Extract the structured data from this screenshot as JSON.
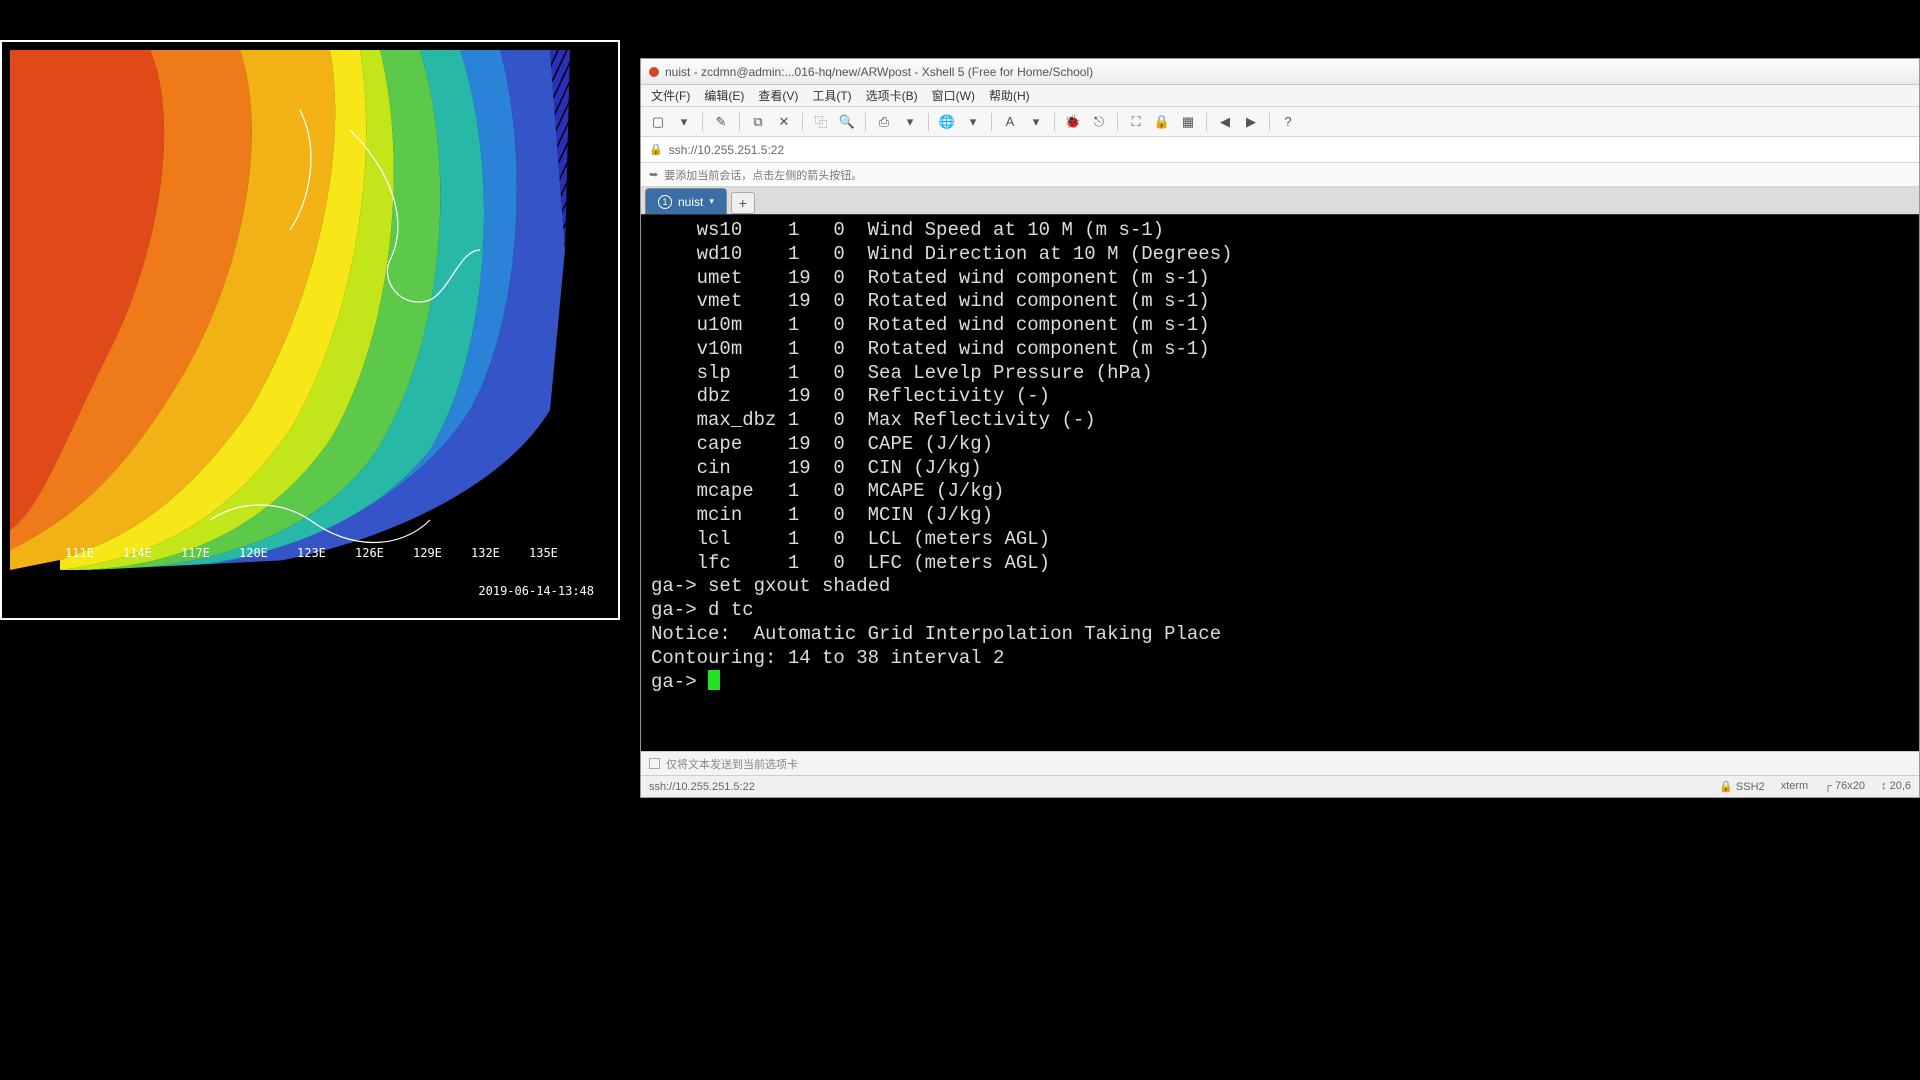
{
  "plot": {
    "axis_labels": [
      "111E",
      "114E",
      "117E",
      "120E",
      "123E",
      "126E",
      "129E",
      "132E",
      "135E"
    ],
    "timestamp": "2019-06-14-13:48"
  },
  "xshell": {
    "title": "nuist - zcdmn@admin:...016-hq/new/ARWpost - Xshell 5 (Free for Home/School)",
    "menu": [
      "文件(F)",
      "编辑(E)",
      "查看(V)",
      "工具(T)",
      "选项卡(B)",
      "窗口(W)",
      "帮助(H)"
    ],
    "toolbar_icons": [
      "new",
      "open",
      "|",
      "wand",
      "|",
      "copy",
      "x",
      "|",
      "dup",
      "search",
      "|",
      "print",
      "dd",
      "|",
      "globe",
      "dd",
      "|",
      "font",
      "dd",
      "|",
      "bug",
      "exit",
      "|",
      "full",
      "lock",
      "tile",
      "|",
      "left",
      "right",
      "|",
      "help"
    ],
    "address": "ssh://10.255.251.5:22",
    "hint": "要添加当前会话，点击左侧的箭头按钮。",
    "tab": {
      "index": "1",
      "label": "nuist"
    },
    "compose_hint": "仅将文本发送到当前选项卡",
    "status": {
      "left": "ssh://10.255.251.5:22",
      "ssh": "SSH2",
      "term": "xterm",
      "size": "76x20",
      "pos": "20,6"
    }
  },
  "terminal": {
    "vars": [
      {
        "name": "ws10",
        "a": "1",
        "b": "0",
        "desc": "Wind Speed at 10 M (m s-1)"
      },
      {
        "name": "wd10",
        "a": "1",
        "b": "0",
        "desc": "Wind Direction at 10 M (Degrees)"
      },
      {
        "name": "umet",
        "a": "19",
        "b": "0",
        "desc": "Rotated wind component (m s-1)"
      },
      {
        "name": "vmet",
        "a": "19",
        "b": "0",
        "desc": "Rotated wind component (m s-1)"
      },
      {
        "name": "u10m",
        "a": "1",
        "b": "0",
        "desc": "Rotated wind component (m s-1)"
      },
      {
        "name": "v10m",
        "a": "1",
        "b": "0",
        "desc": "Rotated wind component (m s-1)"
      },
      {
        "name": "slp",
        "a": "1",
        "b": "0",
        "desc": "Sea Levelp Pressure (hPa)"
      },
      {
        "name": "dbz",
        "a": "19",
        "b": "0",
        "desc": "Reflectivity (-)"
      },
      {
        "name": "max_dbz",
        "a": "1",
        "b": "0",
        "desc": "Max Reflectivity (-)"
      },
      {
        "name": "cape",
        "a": "19",
        "b": "0",
        "desc": "CAPE (J/kg)"
      },
      {
        "name": "cin",
        "a": "19",
        "b": "0",
        "desc": "CIN (J/kg)"
      },
      {
        "name": "mcape",
        "a": "1",
        "b": "0",
        "desc": "MCAPE (J/kg)"
      },
      {
        "name": "mcin",
        "a": "1",
        "b": "0",
        "desc": "MCIN (J/kg)"
      },
      {
        "name": "lcl",
        "a": "1",
        "b": "0",
        "desc": "LCL (meters AGL)"
      },
      {
        "name": "lfc",
        "a": "1",
        "b": "0",
        "desc": "LFC (meters AGL)"
      }
    ],
    "cmds": [
      "ga-> set gxout shaded",
      "ga-> d tc",
      "Notice:  Automatic Grid Interpolation Taking Place",
      "Contouring: 14 to 38 interval 2",
      "ga-> "
    ]
  },
  "icon_glyphs": {
    "new": "▢",
    "open": "▾",
    "wand": "✎",
    "copy": "⧉",
    "x": "✕",
    "dup": "⿻",
    "search": "🔍",
    "print": "⎙",
    "dd": "▾",
    "globe": "🌐",
    "font": "A",
    "bug": "🐞",
    "exit": "⎋",
    "full": "⛶",
    "lock": "🔒",
    "tile": "▦",
    "left": "◀",
    "right": "▶",
    "help": "?"
  }
}
